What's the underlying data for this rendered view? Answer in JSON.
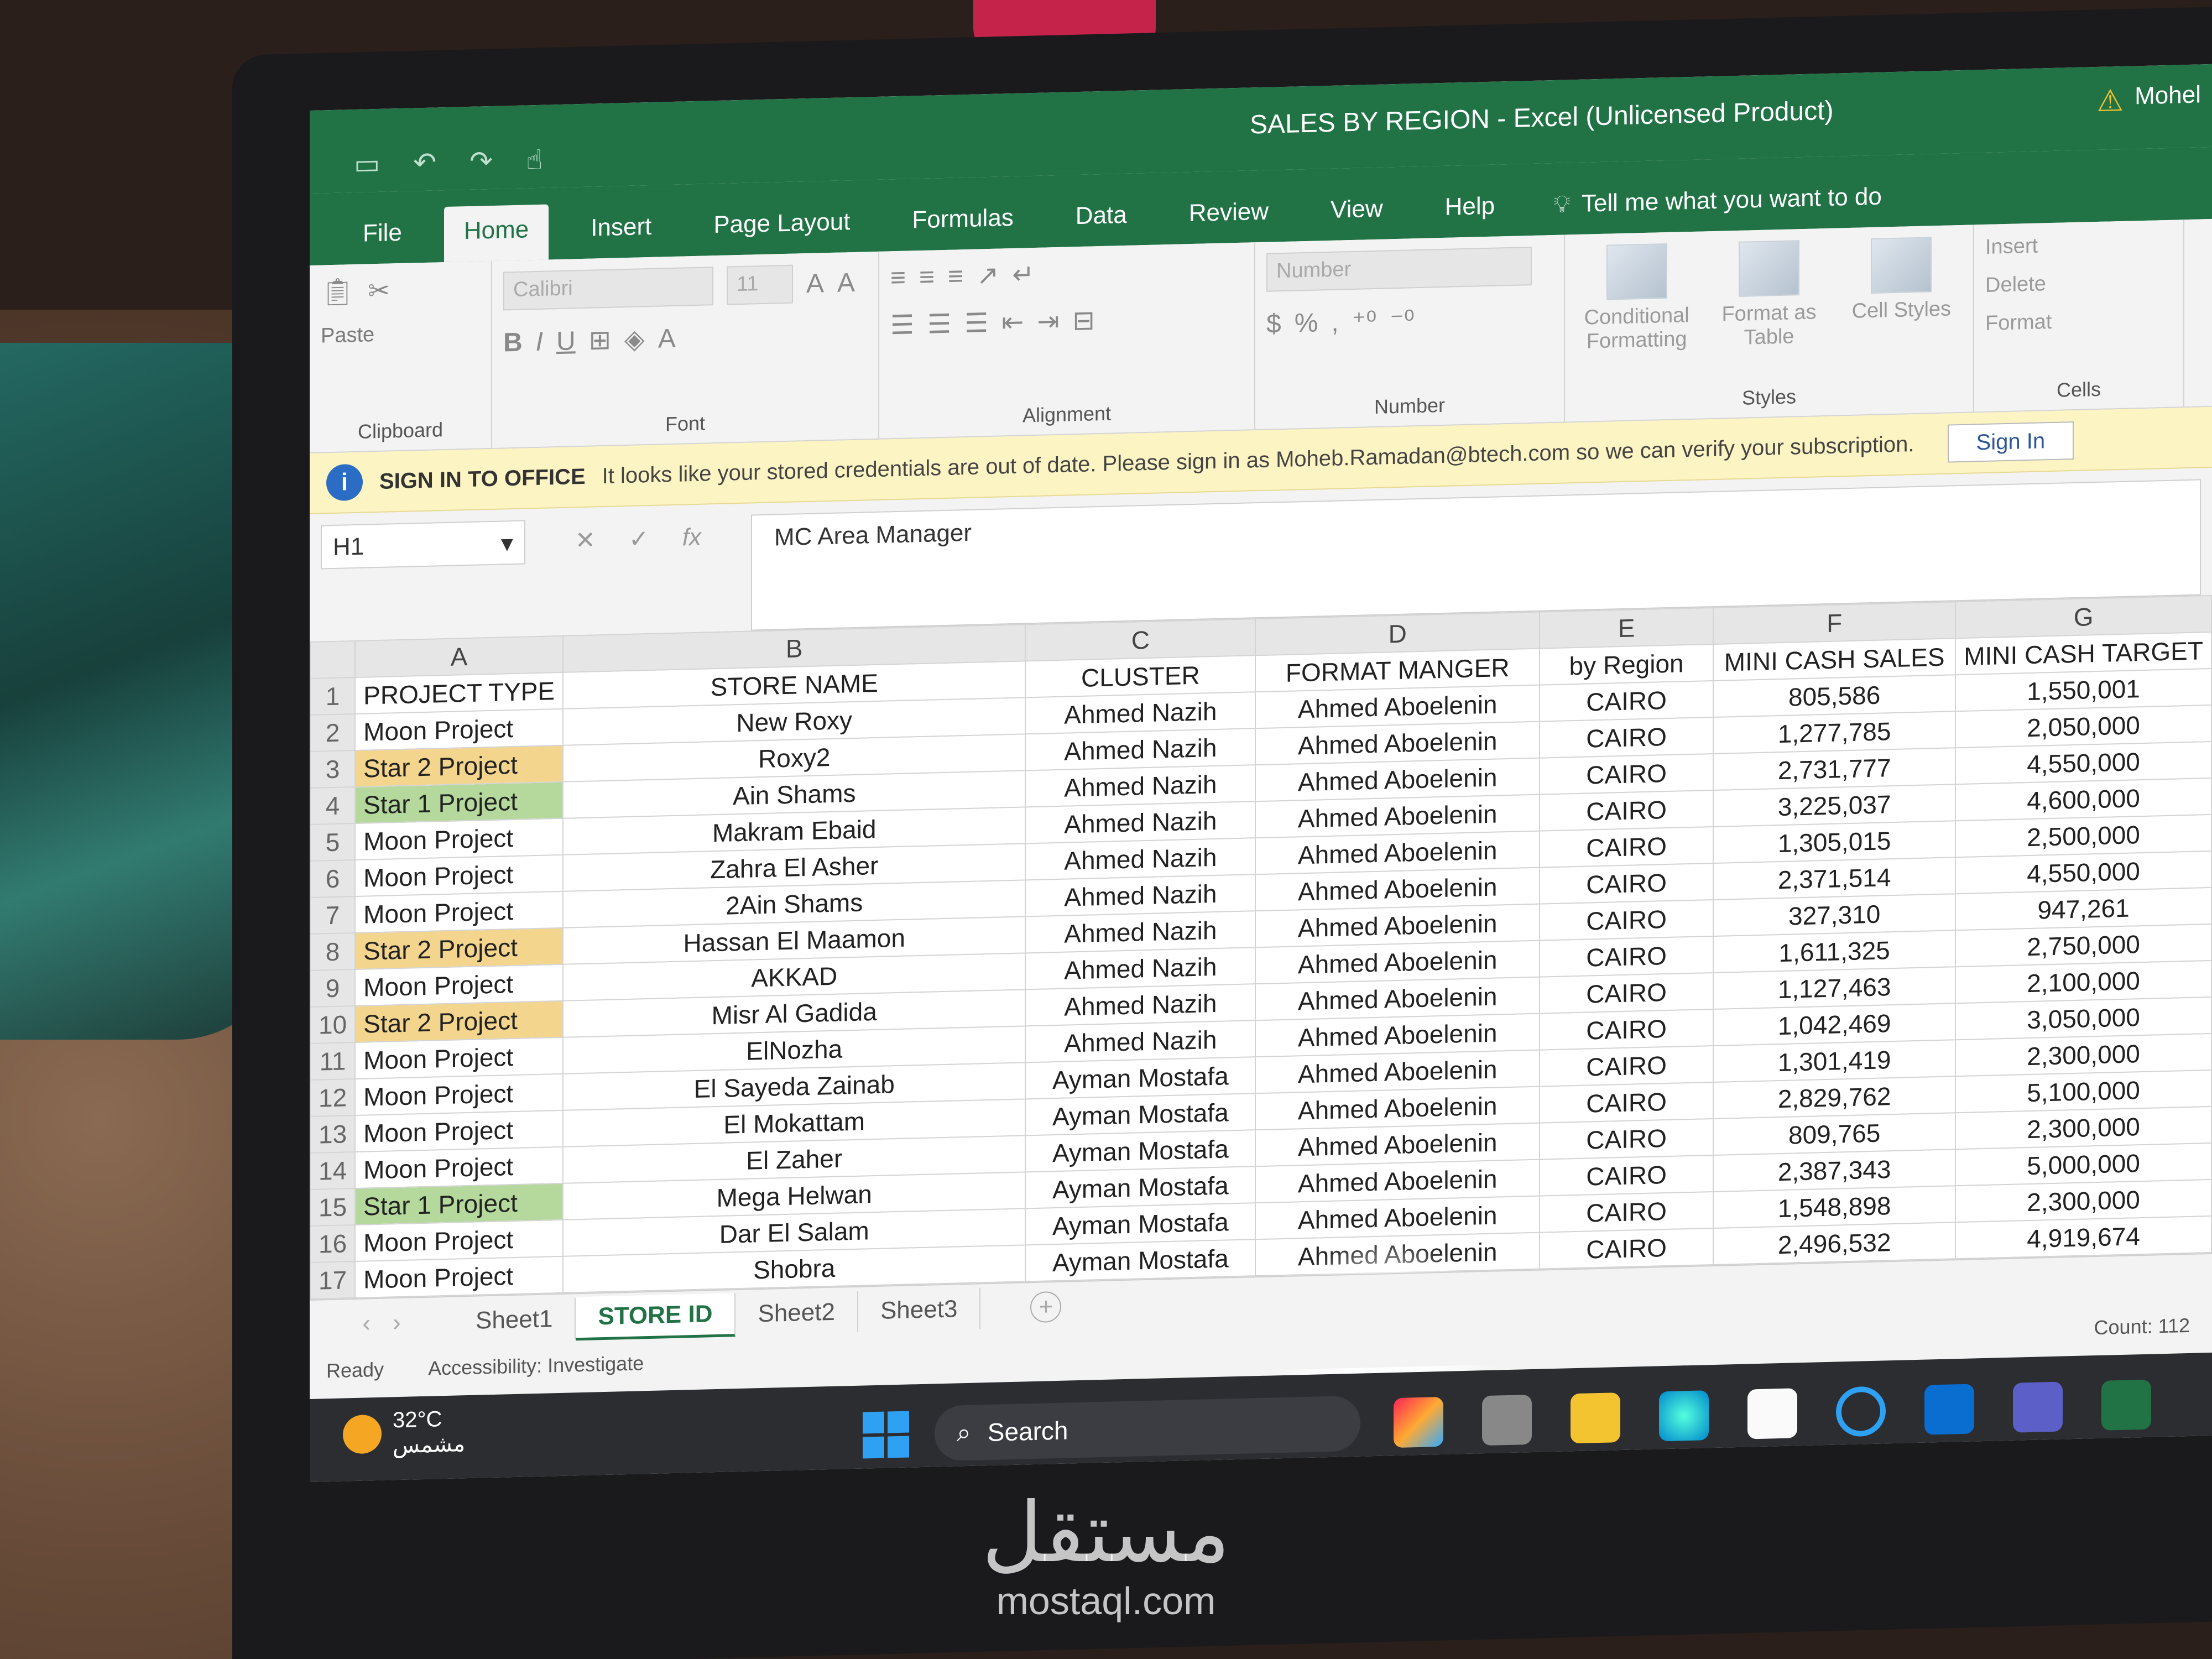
{
  "window": {
    "title": "SALES BY REGION  -  Excel (Unlicensed Product)",
    "user": "Mohel"
  },
  "tabs": [
    "File",
    "Home",
    "Insert",
    "Page Layout",
    "Formulas",
    "Data",
    "Review",
    "View",
    "Help"
  ],
  "tell_me": "Tell me what you want to do",
  "ribbon": {
    "clipboard": {
      "paste": "Paste",
      "label": "Clipboard"
    },
    "font": {
      "name": "Calibri",
      "size": "11",
      "label": "Font"
    },
    "alignment": {
      "label": "Alignment"
    },
    "number": {
      "format": "Number",
      "label": "Number"
    },
    "styles": {
      "conditional": "Conditional Formatting",
      "format_table": "Format as Table",
      "cell_styles": "Cell Styles",
      "label": "Styles"
    },
    "cells": {
      "insert": "Insert",
      "delete": "Delete",
      "format": "Format",
      "label": "Cells"
    }
  },
  "message_bar": {
    "title": "SIGN IN TO OFFICE",
    "text": "It looks like your stored credentials are out of date. Please sign in as Moheb.Ramadan@btech.com so we can verify your subscription.",
    "button": "Sign In"
  },
  "formula_bar": {
    "name_box": "H1",
    "formula": "MC Area Manager"
  },
  "columns": [
    "A",
    "B",
    "C",
    "D",
    "E",
    "F",
    "G"
  ],
  "headers": [
    "PROJECT TYPE",
    "STORE NAME",
    "CLUSTER",
    "FORMAT MANGER",
    "by Region",
    "MINI CASH SALES",
    "MINI CASH TARGET"
  ],
  "rows": [
    {
      "num": "2",
      "type": "Moon Project",
      "store": "New Roxy",
      "cluster": "Ahmed Nazih",
      "manager": "Ahmed Aboelenin",
      "region": "CAIRO",
      "sales": "805,586",
      "target": "1,550,001"
    },
    {
      "num": "3",
      "type": "Star 2 Project",
      "store": "Roxy2",
      "cluster": "Ahmed Nazih",
      "manager": "Ahmed Aboelenin",
      "region": "CAIRO",
      "sales": "1,277,785",
      "target": "2,050,000"
    },
    {
      "num": "4",
      "type": "Star 1 Project",
      "store": "Ain Shams",
      "cluster": "Ahmed Nazih",
      "manager": "Ahmed Aboelenin",
      "region": "CAIRO",
      "sales": "2,731,777",
      "target": "4,550,000"
    },
    {
      "num": "5",
      "type": "Moon Project",
      "store": "Makram Ebaid",
      "cluster": "Ahmed Nazih",
      "manager": "Ahmed Aboelenin",
      "region": "CAIRO",
      "sales": "3,225,037",
      "target": "4,600,000"
    },
    {
      "num": "6",
      "type": "Moon Project",
      "store": "Zahra El Asher",
      "cluster": "Ahmed Nazih",
      "manager": "Ahmed Aboelenin",
      "region": "CAIRO",
      "sales": "1,305,015",
      "target": "2,500,000"
    },
    {
      "num": "7",
      "type": "Moon Project",
      "store": "2Ain Shams",
      "cluster": "Ahmed Nazih",
      "manager": "Ahmed Aboelenin",
      "region": "CAIRO",
      "sales": "2,371,514",
      "target": "4,550,000"
    },
    {
      "num": "8",
      "type": "Star 2 Project",
      "store": "Hassan El Maamon",
      "cluster": "Ahmed Nazih",
      "manager": "Ahmed Aboelenin",
      "region": "CAIRO",
      "sales": "327,310",
      "target": "947,261"
    },
    {
      "num": "9",
      "type": "Moon Project",
      "store": "AKKAD",
      "cluster": "Ahmed Nazih",
      "manager": "Ahmed Aboelenin",
      "region": "CAIRO",
      "sales": "1,611,325",
      "target": "2,750,000"
    },
    {
      "num": "10",
      "type": "Star 2 Project",
      "store": "Misr Al Gadida",
      "cluster": "Ahmed Nazih",
      "manager": "Ahmed Aboelenin",
      "region": "CAIRO",
      "sales": "1,127,463",
      "target": "2,100,000"
    },
    {
      "num": "11",
      "type": "Moon Project",
      "store": "ElNozha",
      "cluster": "Ahmed Nazih",
      "manager": "Ahmed Aboelenin",
      "region": "CAIRO",
      "sales": "1,042,469",
      "target": "3,050,000"
    },
    {
      "num": "12",
      "type": "Moon Project",
      "store": "El Sayeda Zainab",
      "cluster": "Ayman Mostafa",
      "manager": "Ahmed Aboelenin",
      "region": "CAIRO",
      "sales": "1,301,419",
      "target": "2,300,000"
    },
    {
      "num": "13",
      "type": "Moon Project",
      "store": "El Mokattam",
      "cluster": "Ayman Mostafa",
      "manager": "Ahmed Aboelenin",
      "region": "CAIRO",
      "sales": "2,829,762",
      "target": "5,100,000"
    },
    {
      "num": "14",
      "type": "Moon Project",
      "store": "El Zaher",
      "cluster": "Ayman Mostafa",
      "manager": "Ahmed Aboelenin",
      "region": "CAIRO",
      "sales": "809,765",
      "target": "2,300,000"
    },
    {
      "num": "15",
      "type": "Star 1 Project",
      "store": "Mega Helwan",
      "cluster": "Ayman Mostafa",
      "manager": "Ahmed Aboelenin",
      "region": "CAIRO",
      "sales": "2,387,343",
      "target": "5,000,000"
    },
    {
      "num": "16",
      "type": "Moon Project",
      "store": "Dar El Salam",
      "cluster": "Ayman Mostafa",
      "manager": "Ahmed Aboelenin",
      "region": "CAIRO",
      "sales": "1,548,898",
      "target": "2,300,000"
    },
    {
      "num": "17",
      "type": "Moon Project",
      "store": "Shobra",
      "cluster": "Ayman Mostafa",
      "manager": "Ahmed Aboelenin",
      "region": "CAIRO",
      "sales": "2,496,532",
      "target": "4,919,674"
    }
  ],
  "sheets": [
    "Sheet1",
    "STORE ID",
    "Sheet2",
    "Sheet3"
  ],
  "status": {
    "ready": "Ready",
    "accessibility": "Accessibility: Investigate",
    "count": "Count: 112"
  },
  "taskbar": {
    "temperature": "32°C",
    "weather": "مشمس",
    "search": "Search"
  },
  "watermark": {
    "logo": "مستقل",
    "url": "mostaql.com"
  },
  "colors": {
    "excel_green": "#217346",
    "star2_fill": "#f4d58d",
    "star1_fill": "#b5d99c"
  }
}
